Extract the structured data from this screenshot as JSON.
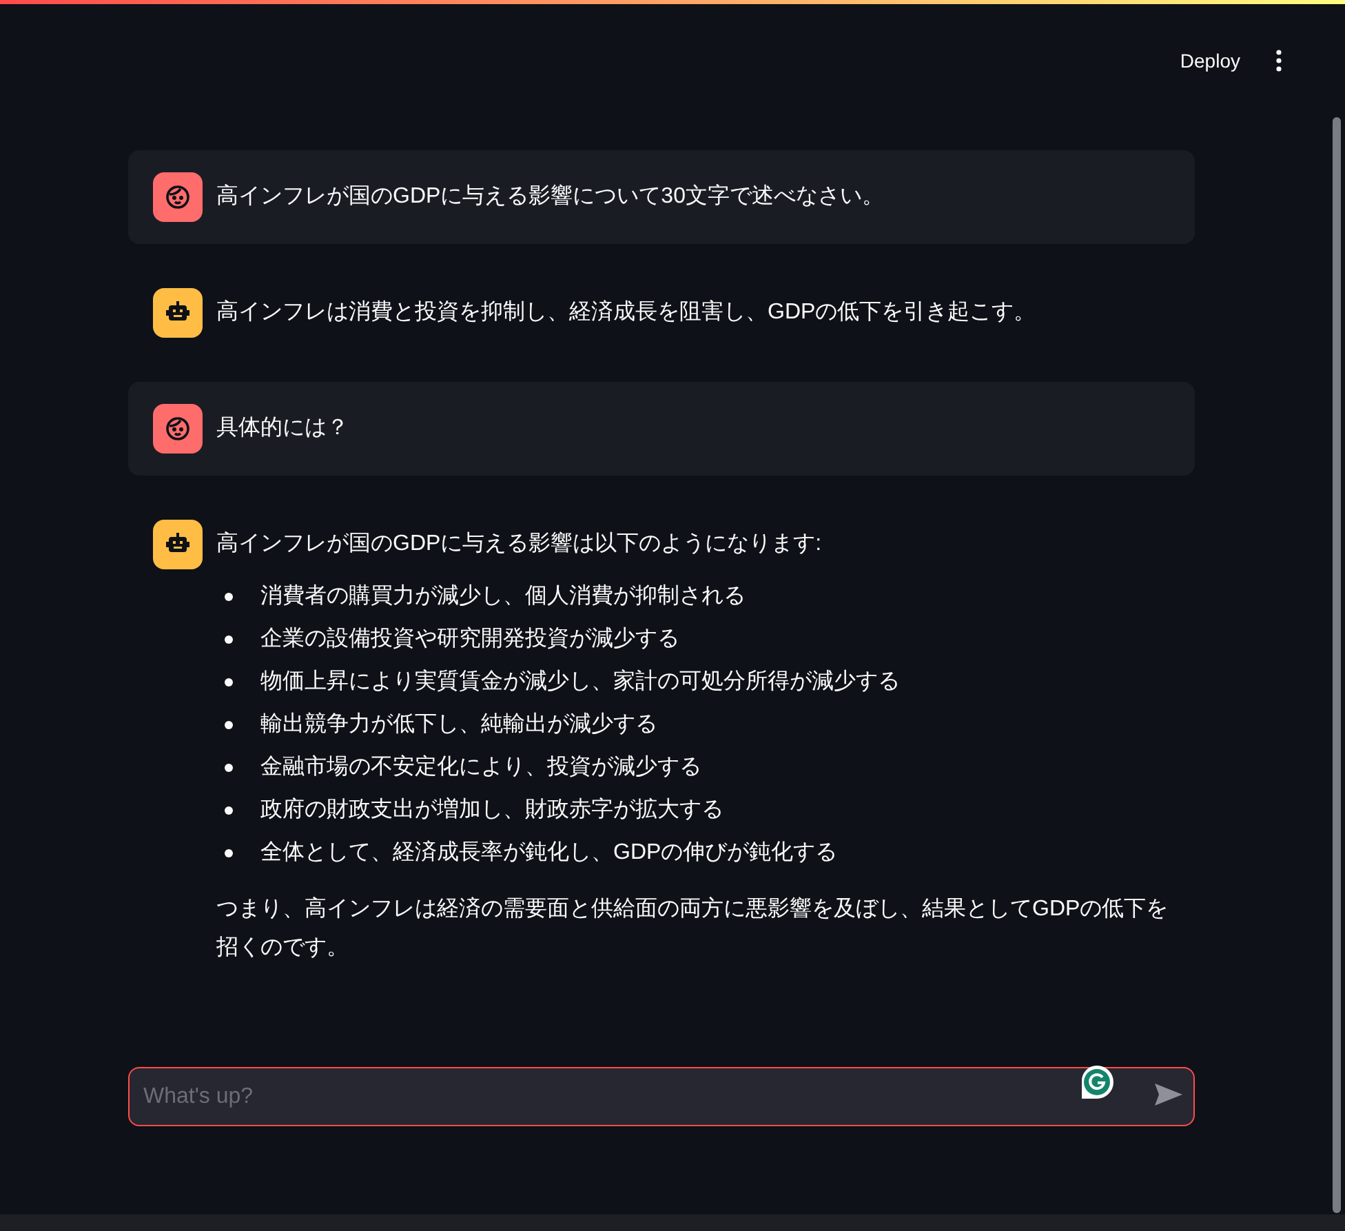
{
  "header": {
    "deploy": "Deploy"
  },
  "messages": [
    {
      "kind": "user",
      "paragraphs": [
        "高インフレが国のGDPに与える影響について30文字で述べなさい。"
      ]
    },
    {
      "kind": "assistant",
      "paragraphs": [
        "高インフレは消費と投資を抑制し、経済成長を阻害し、GDPの低下を引き起こす。"
      ]
    },
    {
      "kind": "user",
      "paragraphs": [
        "具体的には？"
      ]
    },
    {
      "kind": "assistant",
      "paragraphs": [
        "高インフレが国のGDPに与える影響は以下のようになります:"
      ],
      "bullets": [
        "消費者の購買力が減少し、個人消費が抑制される",
        "企業の設備投資や研究開発投資が減少する",
        "物価上昇により実質賃金が減少し、家計の可処分所得が減少する",
        "輸出競争力が低下し、純輸出が減少する",
        "金融市場の不安定化により、投資が減少する",
        "政府の財政支出が増加し、財政赤字が拡大する",
        "全体として、経済成長率が鈍化し、GDPの伸びが鈍化する"
      ],
      "closing": "つまり、高インフレは経済の需要面と供給面の両方に悪影響を及ぼし、結果としてGDPの低下を招くのです。"
    }
  ],
  "chat_input": {
    "placeholder": "What's up?"
  }
}
